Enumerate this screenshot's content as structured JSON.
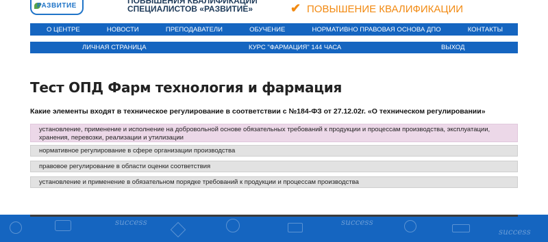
{
  "header": {
    "logo_text": "РАЗВИТИЕ",
    "org_line1": "повышения квалификации",
    "org_line2": "СПЕЦИАЛИСТОВ «РАЗВИТИЕ»",
    "promo_check": "✔",
    "promo_text": "ПОВЫШЕНИЕ КВАЛИФИКАЦИИ"
  },
  "nav_main": [
    "О ЦЕНТРЕ",
    "НОВОСТИ",
    "ПРЕПОДАВАТЕЛИ",
    "ОБУЧЕНИЕ",
    "НОРМАТИВНО ПРАВОВАЯ ОСНОВА ДПО",
    "КОНТАКТЫ"
  ],
  "nav_sub": [
    "ЛИЧНАЯ СТРАНИЦА",
    "КУРС \"ФАРМАЦИЯ\" 144 ЧАСА",
    "ВЫХОД"
  ],
  "page_title": "Тест ОПД Фарм технология и фармация",
  "question": "Какие элементы входят в техническое регулирование в соответствии с №184-ФЗ от 27.12.02г. «О техническом регулировании»",
  "answers": [
    "установление, применение и исполнение на добровольной основе обязательных требований к продукции и процессам производства, эксплуатации, хранения, перевозки, реализации и утилизации",
    "нормативное регулирование в сфере организации производства",
    "правовое регулирование в области оценки соответствия",
    "установление и применение в обязательном порядке требований к продукции и процессам производства"
  ],
  "footer_doodle": "success",
  "colors": {
    "nav": "#1565c0",
    "accent": "#f28a12",
    "selected": "#ecd8e8",
    "answer": "#e2e2e2"
  }
}
